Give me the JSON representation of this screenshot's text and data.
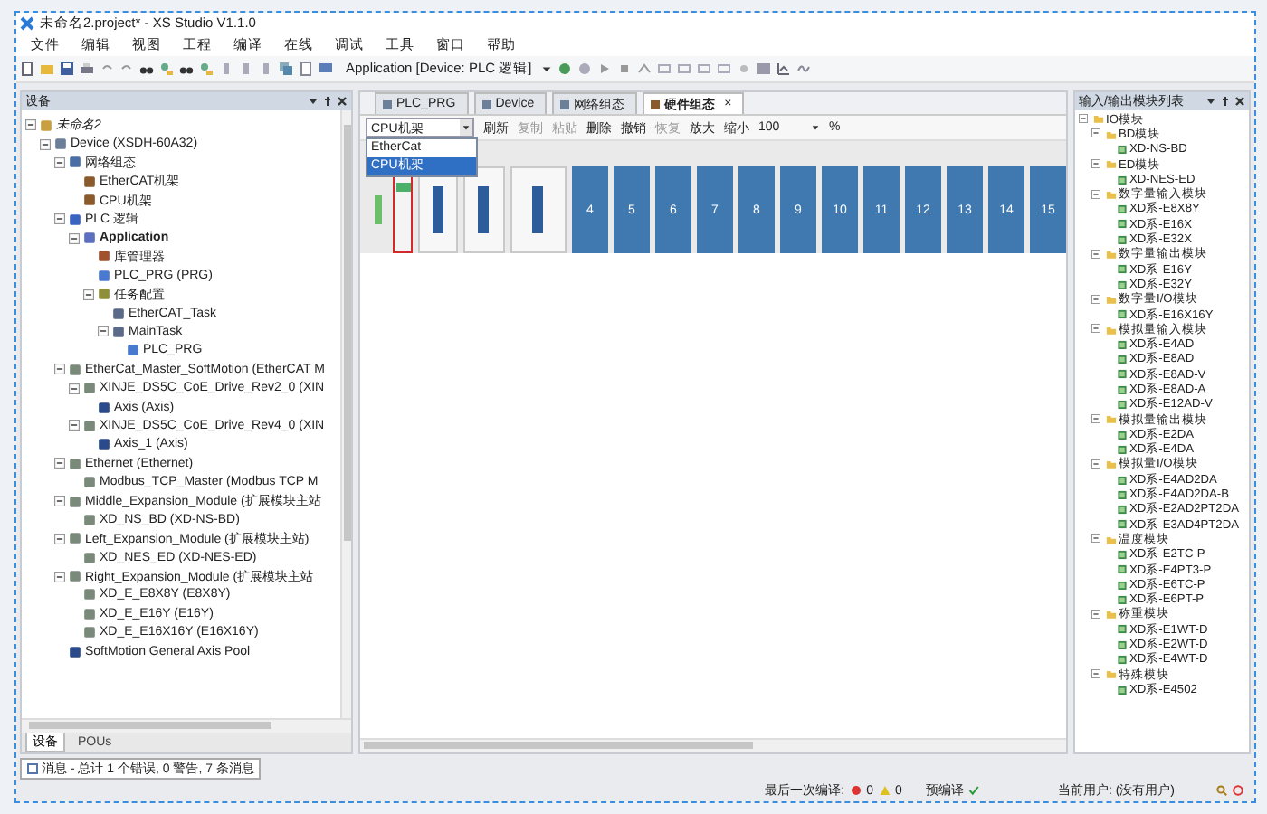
{
  "window": {
    "title": "未命名2.project* - XS Studio V1.1.0"
  },
  "menu": [
    "文件",
    "编辑",
    "视图",
    "工程",
    "编译",
    "在线",
    "调试",
    "工具",
    "窗口",
    "帮助"
  ],
  "toolbar": {
    "context": "Application [Device: PLC 逻辑]"
  },
  "devices_panel": {
    "title": "设备",
    "tree": [
      {
        "label": "未命名2",
        "kind": "root",
        "italic": true,
        "expanded": true,
        "children": [
          {
            "label": "Device (XSDH-60A32)",
            "kind": "device",
            "expanded": true,
            "children": [
              {
                "label": "网络组态",
                "kind": "network",
                "expanded": true,
                "children": [
                  {
                    "label": "EtherCAT机架",
                    "kind": "rack"
                  },
                  {
                    "label": "CPU机架",
                    "kind": "rack"
                  }
                ]
              },
              {
                "label": "PLC 逻辑",
                "kind": "logic",
                "expanded": true,
                "children": [
                  {
                    "label": "Application",
                    "kind": "app",
                    "bold": true,
                    "expanded": true,
                    "children": [
                      {
                        "label": "库管理器",
                        "kind": "library"
                      },
                      {
                        "label": "PLC_PRG (PRG)",
                        "kind": "prg"
                      },
                      {
                        "label": "任务配置",
                        "kind": "tasks",
                        "expanded": true,
                        "children": [
                          {
                            "label": "EtherCAT_Task",
                            "kind": "task"
                          },
                          {
                            "label": "MainTask",
                            "kind": "task",
                            "expanded": true,
                            "children": [
                              {
                                "label": "PLC_PRG",
                                "kind": "prg"
                              }
                            ]
                          }
                        ]
                      }
                    ]
                  }
                ]
              },
              {
                "label": "EtherCat_Master_SoftMotion (EtherCAT M",
                "kind": "module",
                "expanded": true,
                "children": [
                  {
                    "label": "XINJE_DS5C_CoE_Drive_Rev2_0 (XIN",
                    "kind": "module",
                    "expanded": true,
                    "children": [
                      {
                        "label": "Axis (Axis)",
                        "kind": "axis"
                      }
                    ]
                  },
                  {
                    "label": "XINJE_DS5C_CoE_Drive_Rev4_0 (XIN",
                    "kind": "module",
                    "expanded": true,
                    "children": [
                      {
                        "label": "Axis_1 (Axis)",
                        "kind": "axis"
                      }
                    ]
                  }
                ]
              },
              {
                "label": "Ethernet (Ethernet)",
                "kind": "module",
                "expanded": true,
                "children": [
                  {
                    "label": "Modbus_TCP_Master (Modbus TCP M",
                    "kind": "module"
                  }
                ]
              },
              {
                "label": "Middle_Expansion_Module (扩展模块主站",
                "kind": "module",
                "expanded": true,
                "children": [
                  {
                    "label": "XD_NS_BD (XD-NS-BD)",
                    "kind": "module"
                  }
                ]
              },
              {
                "label": "Left_Expansion_Module (扩展模块主站)",
                "kind": "module",
                "expanded": true,
                "children": [
                  {
                    "label": "XD_NES_ED (XD-NES-ED)",
                    "kind": "module"
                  }
                ]
              },
              {
                "label": "Right_Expansion_Module (扩展模块主站",
                "kind": "module",
                "expanded": true,
                "children": [
                  {
                    "label": "XD_E_E8X8Y (E8X8Y)",
                    "kind": "module"
                  },
                  {
                    "label": "XD_E_E16Y (E16Y)",
                    "kind": "module"
                  },
                  {
                    "label": "XD_E_E16X16Y (E16X16Y)",
                    "kind": "module"
                  }
                ]
              },
              {
                "label": "SoftMotion General Axis Pool",
                "kind": "axis"
              }
            ]
          }
        ]
      }
    ],
    "tabs": [
      {
        "label": "设备",
        "selected": true
      },
      {
        "label": "POUs",
        "selected": false
      }
    ]
  },
  "editor_tabs": [
    {
      "label": "PLC_PRG",
      "selected": false
    },
    {
      "label": "Device",
      "selected": false
    },
    {
      "label": "网络组态",
      "selected": false
    },
    {
      "label": "硬件组态",
      "selected": true,
      "close": "×"
    }
  ],
  "hardware": {
    "rack_select": {
      "value": "CPU机架",
      "options": [
        {
          "label": "EtherCat",
          "selected": false
        },
        {
          "label": "CPU机架",
          "selected": true
        }
      ]
    },
    "actions": [
      {
        "label": "刷新",
        "disabled": false
      },
      {
        "label": "复制",
        "disabled": true
      },
      {
        "label": "粘贴",
        "disabled": true
      },
      {
        "label": "删除",
        "disabled": false
      },
      {
        "label": "撤销",
        "disabled": false
      },
      {
        "label": "恢复",
        "disabled": true
      },
      {
        "label": "放大",
        "disabled": false
      },
      {
        "label": "缩小",
        "disabled": false
      }
    ],
    "zoom": "100",
    "zoom_unit": "%",
    "slots": [
      {
        "kind": "power",
        "selected": false
      },
      {
        "kind": "cpu",
        "selected": true
      },
      {
        "kind": "module",
        "selected": false
      },
      {
        "kind": "module",
        "selected": false
      },
      {
        "kind": "wide",
        "selected": false
      },
      {
        "kind": "empty",
        "label": "4",
        "selected": false
      },
      {
        "kind": "empty",
        "label": "5",
        "selected": false
      },
      {
        "kind": "empty",
        "label": "6",
        "selected": false
      },
      {
        "kind": "empty",
        "label": "7",
        "selected": false
      },
      {
        "kind": "empty",
        "label": "8",
        "selected": false
      },
      {
        "kind": "empty",
        "label": "9",
        "selected": false
      },
      {
        "kind": "empty",
        "label": "10",
        "selected": false
      },
      {
        "kind": "empty",
        "label": "11",
        "selected": false
      },
      {
        "kind": "empty",
        "label": "12",
        "selected": false
      },
      {
        "kind": "empty",
        "label": "13",
        "selected": false
      },
      {
        "kind": "empty",
        "label": "14",
        "selected": false
      },
      {
        "kind": "empty",
        "label": "15",
        "selected": false
      }
    ]
  },
  "io_panel": {
    "title": "输入/输出模块列表",
    "tree": [
      {
        "label": "IO模块",
        "expanded": true,
        "children": [
          {
            "label": "BD模块",
            "expanded": true,
            "children": [
              {
                "label": "XD-NS-BD"
              }
            ]
          },
          {
            "label": "ED模块",
            "expanded": true,
            "children": [
              {
                "label": "XD-NES-ED"
              }
            ]
          },
          {
            "label": "数字量输入模块",
            "expanded": true,
            "children": [
              {
                "label": "XD系-E8X8Y"
              },
              {
                "label": "XD系-E16X"
              },
              {
                "label": "XD系-E32X"
              }
            ]
          },
          {
            "label": "数字量输出模块",
            "expanded": true,
            "children": [
              {
                "label": "XD系-E16Y"
              },
              {
                "label": "XD系-E32Y"
              }
            ]
          },
          {
            "label": "数字量I/O模块",
            "expanded": true,
            "children": [
              {
                "label": "XD系-E16X16Y"
              }
            ]
          },
          {
            "label": "模拟量输入模块",
            "expanded": true,
            "children": [
              {
                "label": "XD系-E4AD"
              },
              {
                "label": "XD系-E8AD"
              },
              {
                "label": "XD系-E8AD-V"
              },
              {
                "label": "XD系-E8AD-A"
              },
              {
                "label": "XD系-E12AD-V"
              }
            ]
          },
          {
            "label": "模拟量输出模块",
            "expanded": true,
            "children": [
              {
                "label": "XD系-E2DA"
              },
              {
                "label": "XD系-E4DA"
              }
            ]
          },
          {
            "label": "模拟量I/O模块",
            "expanded": true,
            "children": [
              {
                "label": "XD系-E4AD2DA"
              },
              {
                "label": "XD系-E4AD2DA-B"
              },
              {
                "label": "XD系-E2AD2PT2DA"
              },
              {
                "label": "XD系-E3AD4PT2DA"
              }
            ]
          },
          {
            "label": "温度模块",
            "expanded": true,
            "children": [
              {
                "label": "XD系-E2TC-P"
              },
              {
                "label": "XD系-E4PT3-P"
              },
              {
                "label": "XD系-E6TC-P"
              },
              {
                "label": "XD系-E6PT-P"
              }
            ]
          },
          {
            "label": "称重模块",
            "expanded": true,
            "children": [
              {
                "label": "XD系-E1WT-D"
              },
              {
                "label": "XD系-E2WT-D"
              },
              {
                "label": "XD系-E4WT-D"
              }
            ]
          },
          {
            "label": "特殊模块",
            "expanded": true,
            "children": [
              {
                "label": "XD系-E4502"
              }
            ]
          }
        ]
      }
    ]
  },
  "messages": {
    "label": "消息 - 总计 1 个错误, 0 警告, 7 条消息"
  },
  "status_bar": {
    "compile_label": "最后一次编译:",
    "errors": "0",
    "warnings": "0",
    "precompile": "预编译",
    "precompile_ok": true,
    "user": "当前用户: (没有用户)"
  }
}
